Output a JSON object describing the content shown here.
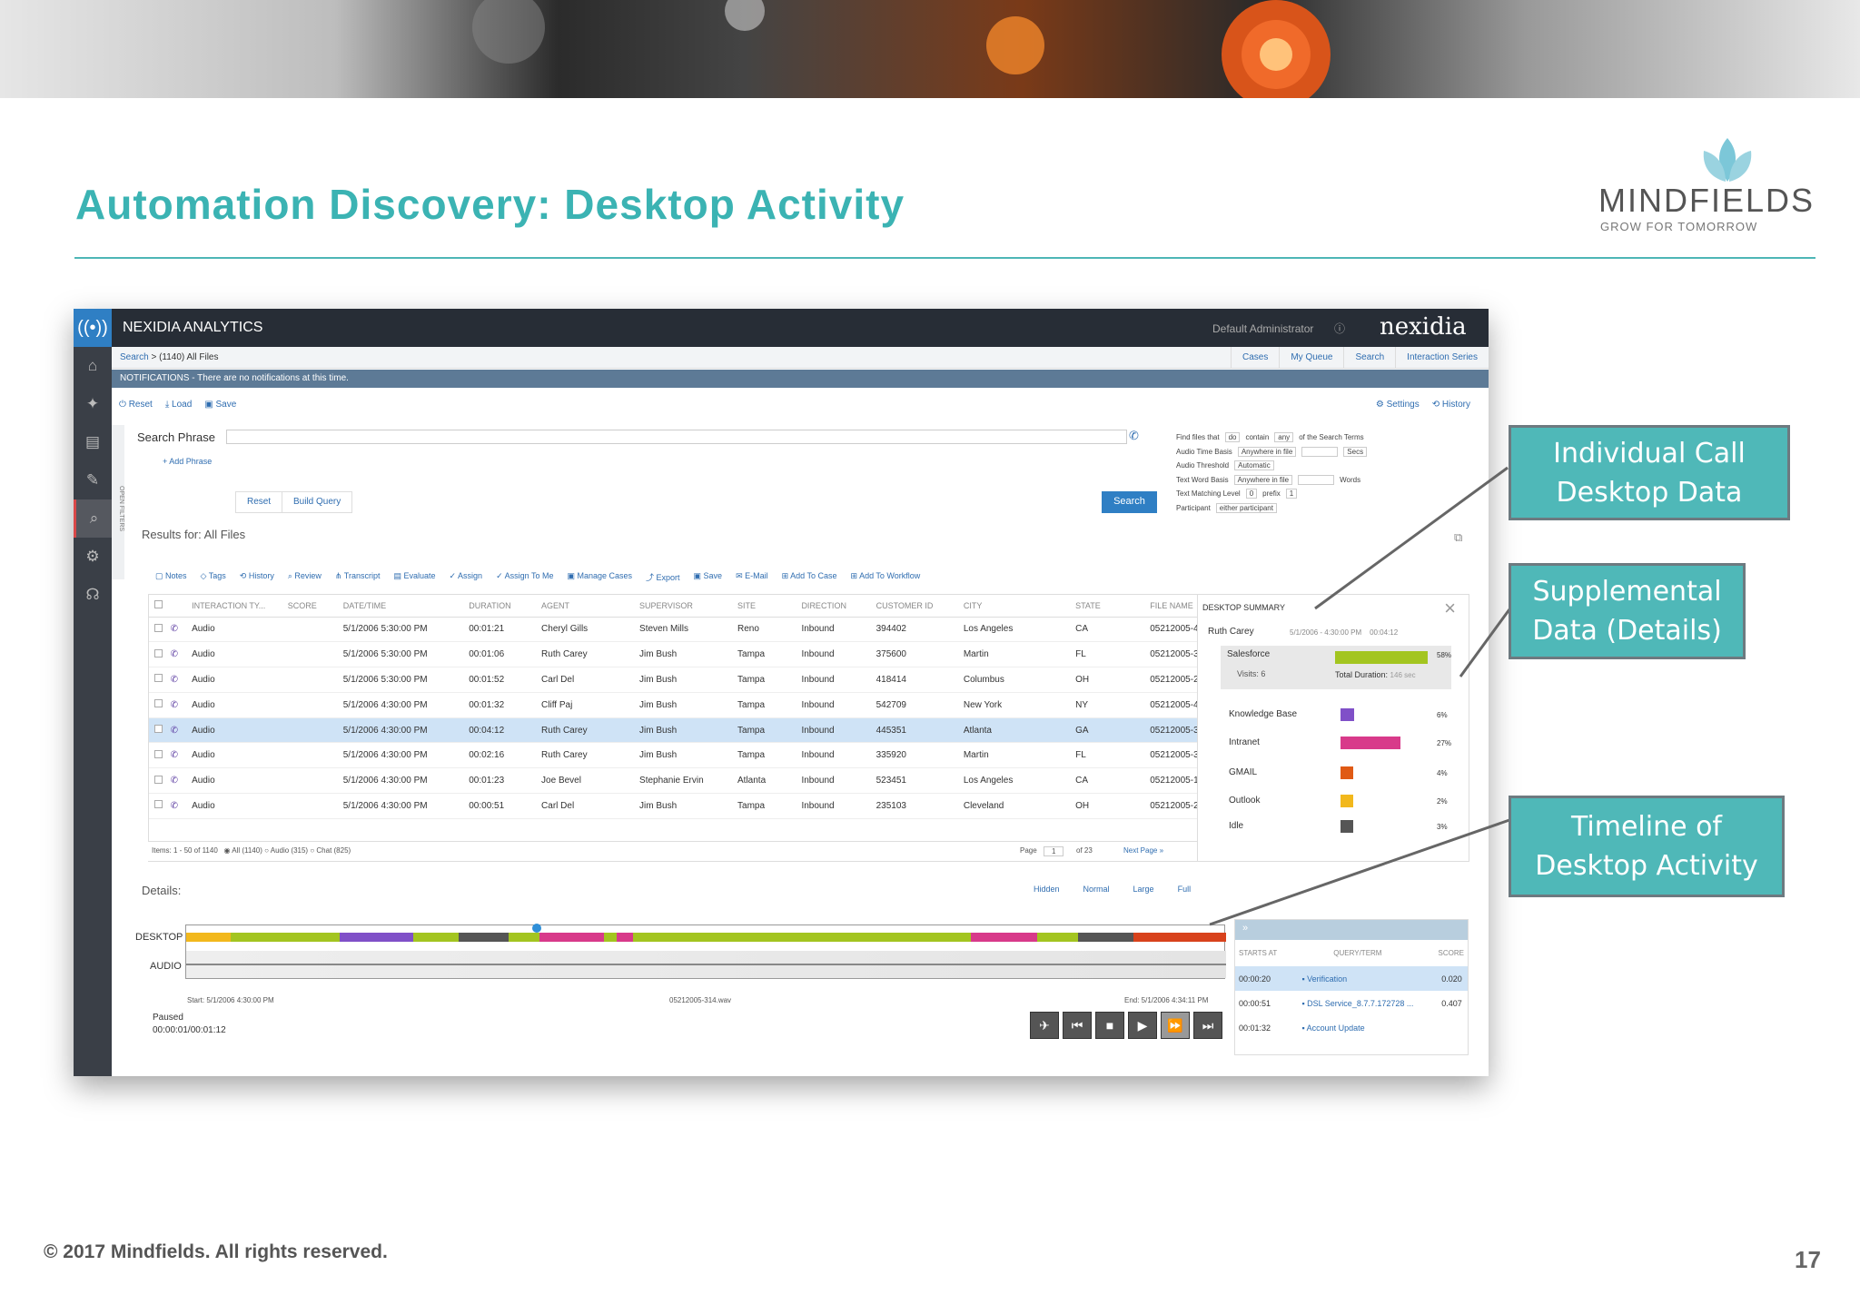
{
  "slide": {
    "title": "Automation Discovery: Desktop Activity",
    "logo_name": "MINDFIELDS",
    "logo_tagline": "GROW FOR TOMORROW",
    "copyright": "© 2017  Mindfields. All rights reserved.",
    "page_number": "17"
  },
  "callouts": {
    "individual_line1": "Individual Call",
    "individual_line2": "Desktop Data",
    "supplemental_line1": "Supplemental",
    "supplemental_line2": "Data (Details)",
    "timeline_line1": "Timeline of",
    "timeline_line2": "Desktop Activity"
  },
  "app": {
    "name": "NEXIDIA ANALYTICS",
    "user": "Default Administrator",
    "brand": "nexidia",
    "icons": {
      "logo": "broadcast-icon",
      "help": "question-icon",
      "info": "info-icon"
    }
  },
  "nav": {
    "breadcrumb_link": "Search",
    "breadcrumb_current": " > (1140) All Files",
    "tabs": [
      "Cases",
      "My Queue",
      "Search",
      "Interaction Series"
    ]
  },
  "notifications": {
    "text": "NOTIFICATIONS - There are no notifications at this time."
  },
  "toolbar": {
    "reset": "Reset",
    "load": "Load",
    "save": "Save",
    "settings": "Settings",
    "history": "History"
  },
  "search": {
    "label": "Search Phrase",
    "value": "",
    "add_phrase": "+ Add Phrase",
    "reset": "Reset",
    "build_query": "Build Query",
    "search": "Search",
    "open_filters": "OPEN FILTERS"
  },
  "filters": {
    "find_label": "Find files that",
    "find_val": "do",
    "contain": "contain",
    "any": "any",
    "of_terms": "of the Search Terms",
    "audio_time": "Audio Time Basis",
    "anywhere1": "Anywhere in file",
    "secs": "Secs",
    "audio_thresh": "Audio Threshold",
    "automatic": "Automatic",
    "text_word": "Text Word Basis",
    "anywhere2": "Anywhere in file",
    "words": "Words",
    "text_match": "Text Matching Level",
    "match_val": "0",
    "prefix": "prefix",
    "prefix_val": "1",
    "participant": "Participant",
    "participant_val": "either participant"
  },
  "results": {
    "title": "Results for: All Files",
    "actions": [
      "Notes",
      "Tags",
      "History",
      "Review",
      "Transcript",
      "Evaluate",
      "Assign",
      "Assign To Me",
      "Manage Cases",
      "Export",
      "Save",
      "E-Mail",
      "Add To Case",
      "Add To Workflow"
    ]
  },
  "table": {
    "headers": [
      "",
      "",
      "INTERACTION TY...",
      "SCORE",
      "DATE/TIME",
      "DURATION",
      "AGENT",
      "SUPERVISOR",
      "SITE",
      "DIRECTION",
      "CUSTOMER ID",
      "CITY",
      "STATE",
      "FILE NAME"
    ],
    "rows": [
      [
        "Audio",
        "",
        "5/1/2006 5:30:00 PM",
        "00:01:21",
        "Cheryl Gills",
        "Steven Mills",
        "Reno",
        "Inbound",
        "394402",
        "Los Angeles",
        "CA",
        "05212005-425"
      ],
      [
        "Audio",
        "",
        "5/1/2006 5:30:00 PM",
        "00:01:06",
        "Ruth Carey",
        "Jim Bush",
        "Tampa",
        "Inbound",
        "375600",
        "Martin",
        "FL",
        "05212005-307"
      ],
      [
        "Audio",
        "",
        "5/1/2006 5:30:00 PM",
        "00:01:52",
        "Carl Del",
        "Jim Bush",
        "Tampa",
        "Inbound",
        "418414",
        "Columbus",
        "OH",
        "05212005-267"
      ],
      [
        "Audio",
        "",
        "5/1/2006 4:30:00 PM",
        "00:01:32",
        "Cliff Paj",
        "Jim Bush",
        "Tampa",
        "Inbound",
        "542709",
        "New York",
        "NY",
        "05212005-409"
      ],
      [
        "Audio",
        "",
        "5/1/2006 4:30:00 PM",
        "00:04:12",
        "Ruth Carey",
        "Jim Bush",
        "Tampa",
        "Inbound",
        "445351",
        "Atlanta",
        "GA",
        "05212005-314"
      ],
      [
        "Audio",
        "",
        "5/1/2006 4:30:00 PM",
        "00:02:16",
        "Ruth Carey",
        "Jim Bush",
        "Tampa",
        "Inbound",
        "335920",
        "Martin",
        "FL",
        "05212005-306"
      ],
      [
        "Audio",
        "",
        "5/1/2006 4:30:00 PM",
        "00:01:23",
        "Joe Bevel",
        "Stephanie Ervin",
        "Atlanta",
        "Inbound",
        "523451",
        "Los Angeles",
        "CA",
        "05212005-159"
      ],
      [
        "Audio",
        "",
        "5/1/2006 4:30:00 PM",
        "00:00:51",
        "Carl Del",
        "Jim Bush",
        "Tampa",
        "Inbound",
        "235103",
        "Cleveland",
        "OH",
        "05212005-258"
      ]
    ],
    "selected_row": 4,
    "footer_items": "Items: 1 - 50   of  1140",
    "radio_all": "All (1140)",
    "radio_audio": "Audio (315)",
    "radio_chat": "Chat (825)",
    "page_label": "Page",
    "page_val": "1",
    "of_pages": "of  23",
    "next_page": "Next Page »"
  },
  "summary": {
    "title": "DESKTOP SUMMARY",
    "agent": "Ruth Carey",
    "date": "5/1/2006 - 4:30:00 PM",
    "duration": "00:04:12",
    "primary": {
      "name": "Salesforce",
      "pct": "58%",
      "value": 0.58,
      "visits": "Visits:  6",
      "total": "Total Duration:",
      "total_val": "146 sec",
      "color": "#a3c520"
    },
    "apps": [
      {
        "name": "Knowledge Base",
        "pct": "6%",
        "value": 0.06,
        "color": "#8050c8"
      },
      {
        "name": "Intranet",
        "pct": "27%",
        "value": 0.27,
        "color": "#d83a8a"
      },
      {
        "name": "GMAIL",
        "pct": "4%",
        "value": 0.04,
        "color": "#e05a14"
      },
      {
        "name": "Outlook",
        "pct": "2%",
        "value": 0.02,
        "color": "#f2b81c"
      },
      {
        "name": "Idle",
        "pct": "3%",
        "value": 0.03,
        "color": "#555555"
      }
    ]
  },
  "details": {
    "title": "Details:",
    "sizes": [
      "Hidden",
      "Normal",
      "Large",
      "Full"
    ],
    "desktop_label": "DESKTOP",
    "audio_label": "AUDIO",
    "start": "Start: 5/1/2006 4:30:00 PM",
    "file": "05212005-314.wav",
    "end": "End: 5/1/2006 4:34:11 PM",
    "status": "Paused",
    "position": "00:00:01/00:01:12",
    "segments": [
      {
        "color": "#f2b81c",
        "w": 0.043
      },
      {
        "color": "#a3c520",
        "w": 0.105
      },
      {
        "color": "#8050c8",
        "w": 0.07
      },
      {
        "color": "#a3c520",
        "w": 0.044
      },
      {
        "color": "#555555",
        "w": 0.048
      },
      {
        "color": "#a3c520",
        "w": 0.03
      },
      {
        "color": "#d83a8a",
        "w": 0.062
      },
      {
        "color": "#a3c520",
        "w": 0.012
      },
      {
        "color": "#d83a8a",
        "w": 0.016
      },
      {
        "color": "#a3c520",
        "w": 0.325
      },
      {
        "color": "#d83a8a",
        "w": 0.063
      },
      {
        "color": "#a3c520",
        "w": 0.04
      },
      {
        "color": "#555555",
        "w": 0.053
      },
      {
        "color": "#d8421c",
        "w": 0.089
      }
    ]
  },
  "query_panel": {
    "headers": [
      "STARTS AT",
      "QUERY/TERM",
      "SCORE"
    ],
    "rows": [
      {
        "time": "00:00:20",
        "term": "Verification",
        "score": "0.020"
      },
      {
        "time": "00:00:51",
        "term": "DSL Service_8.7.7.172728 ...",
        "score": "0.407"
      },
      {
        "time": "00:01:32",
        "term": "Account Update",
        "score": ""
      }
    ]
  }
}
